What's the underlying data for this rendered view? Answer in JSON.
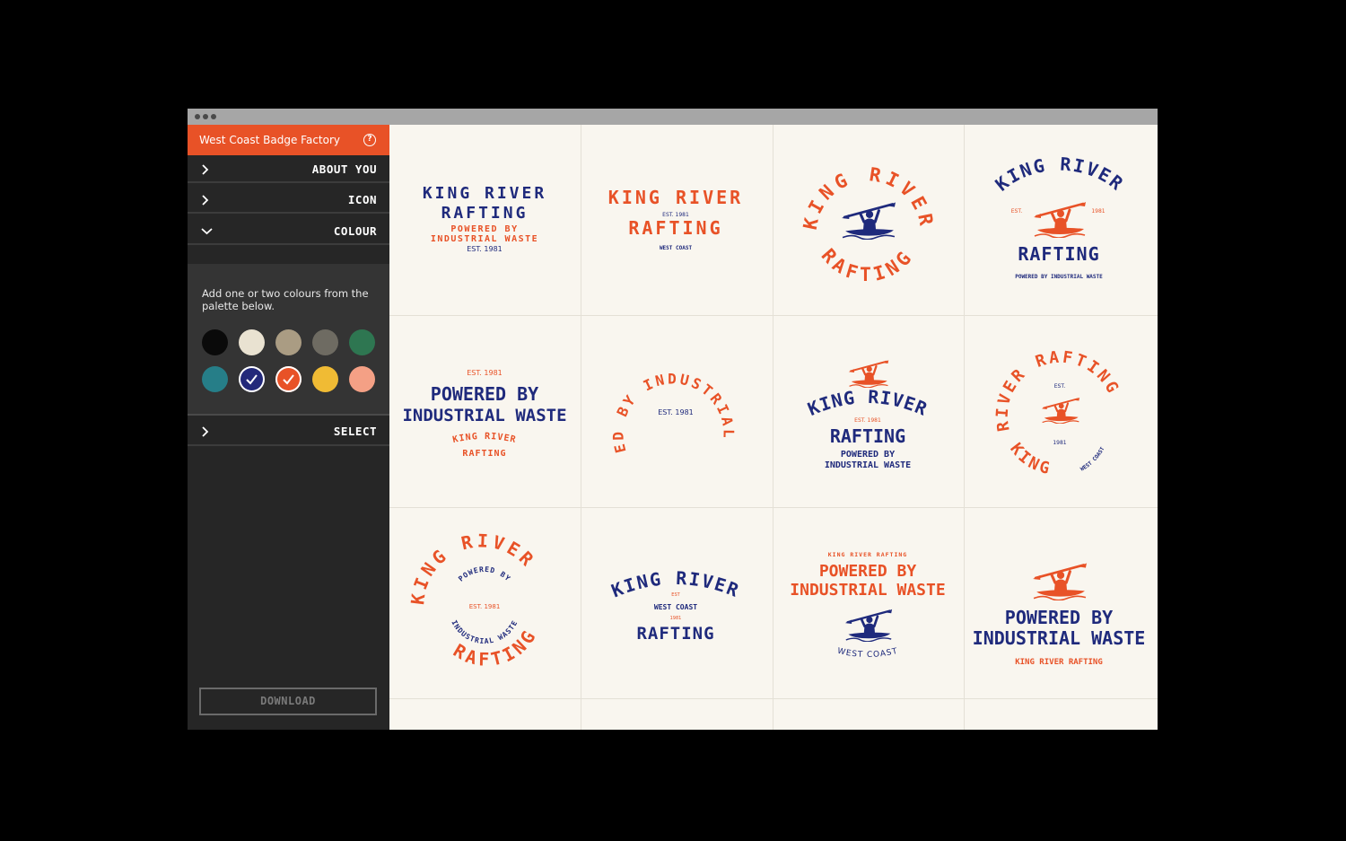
{
  "app": {
    "title": "West Coast Badge Factory"
  },
  "sidebar": {
    "sections": [
      {
        "label": "ABOUT YOU",
        "state": "collapsed"
      },
      {
        "label": "ICON",
        "state": "collapsed"
      },
      {
        "label": "COLOUR",
        "state": "expanded"
      },
      {
        "label": "SELECT",
        "state": "collapsed"
      }
    ],
    "colour_instructions": "Add one or two colours from the palette below.",
    "palette": [
      {
        "color": "#0a0a0a",
        "selected": false
      },
      {
        "color": "#e9e2d1",
        "selected": false
      },
      {
        "color": "#aa9c83",
        "selected": false
      },
      {
        "color": "#6e6b62",
        "selected": false
      },
      {
        "color": "#2e7651",
        "selected": false
      },
      {
        "color": "#267e88",
        "selected": false
      },
      {
        "color": "#23297a",
        "selected": true
      },
      {
        "color": "#e85227",
        "selected": true
      },
      {
        "color": "#f0bb34",
        "selected": false
      },
      {
        "color": "#f4a085",
        "selected": false
      }
    ],
    "download_label": "DOWNLOAD"
  },
  "colors": {
    "navy": "#1f2a7c",
    "orange": "#e85227",
    "accent": "#e85227",
    "cream": "#f9f6ef"
  },
  "badges": {
    "b1": {
      "l1": "KING RIVER",
      "l2": "RAFTING",
      "l3": "POWERED BY",
      "l4": "INDUSTRIAL WASTE",
      "l5": "EST. 1981"
    },
    "b2": {
      "l1": "KING RIVER",
      "l2": "EST. 1981",
      "l3": "RAFTING",
      "l4": "WEST COAST"
    },
    "b3": {
      "arc_top": "KING RIVER",
      "arc_bottom": "RAFTING",
      "icon": "kayaker-icon"
    },
    "b4": {
      "arc_top": "KING RIVER",
      "est": "EST.",
      "year": "1981",
      "l1": "RAFTING",
      "l2": "POWERED BY INDUSTRIAL WASTE",
      "icon": "kayaker-icon"
    },
    "b5": {
      "l0": "EST. 1981",
      "l1": "POWERED BY",
      "l2": "INDUSTRIAL WASTE",
      "l3": "KING RIVER",
      "l4": "RAFTING"
    },
    "b6": {
      "ring": "POWERED BY INDUSTRIAL WASTE",
      "center": "EST. 1981"
    },
    "b7": {
      "arc": "KING RIVER",
      "est": "EST. 1981",
      "l1": "RAFTING",
      "l2": "POWERED BY",
      "l3": "INDUSTRIAL WASTE",
      "icon": "kayaker-icon"
    },
    "b8": {
      "arc_top": "RIVER RAFTING",
      "arc_bottom": "KING",
      "est": "EST.",
      "year": "1981",
      "side": "WEST COAST",
      "icon": "kayaker-icon"
    },
    "b9": {
      "outer_top": "KING RIVER",
      "outer_bottom": "RAFTING",
      "inner_top": "POWERED BY",
      "inner_bottom": "INDUSTRIAL WASTE",
      "center": "EST. 1981"
    },
    "b10": {
      "arc": "KING RIVER",
      "est": "EST",
      "l1": "WEST COAST",
      "year": "1981",
      "l2": "RAFTING"
    },
    "b11": {
      "l0": "KING RIVER RAFTING",
      "l1": "POWERED BY",
      "l2": "INDUSTRIAL WASTE",
      "arc": "WEST COAST",
      "icon": "kayaker-icon"
    },
    "b12": {
      "l1": "POWERED BY",
      "l2": "INDUSTRIAL WASTE",
      "l3": "KING RIVER RAFTING",
      "icon": "kayaker-icon"
    }
  }
}
